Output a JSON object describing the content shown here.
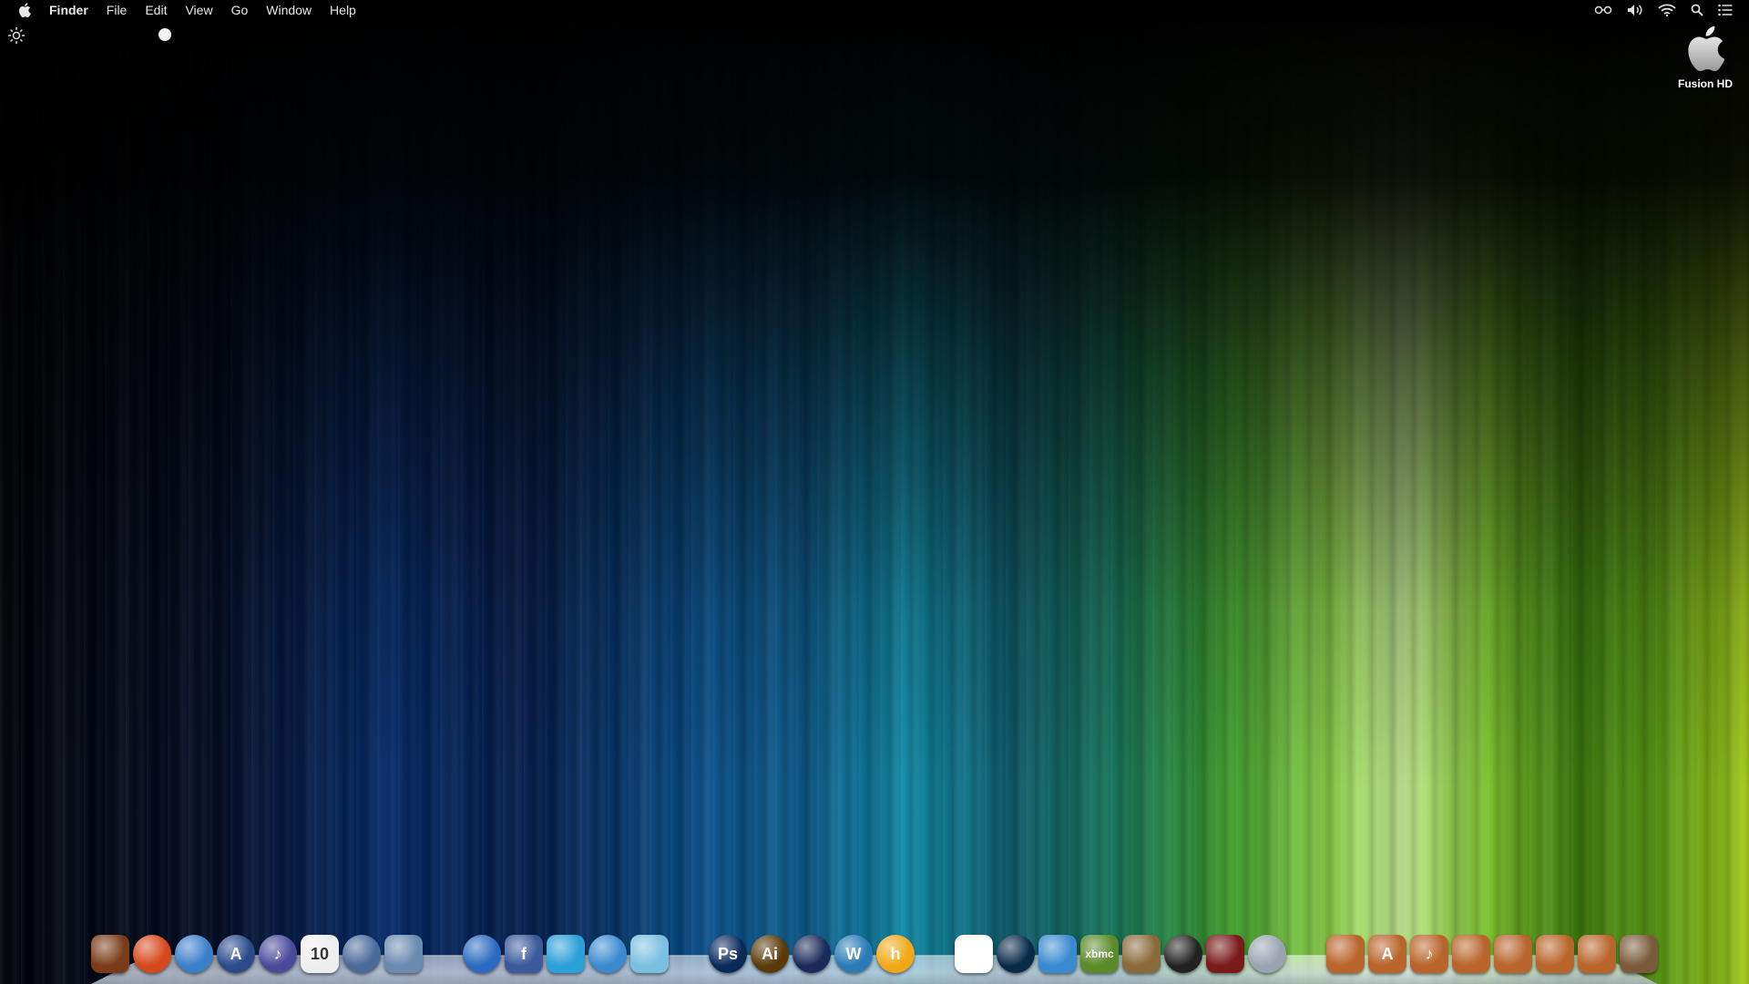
{
  "menubar": {
    "app_name": "Finder",
    "menus": [
      "File",
      "Edit",
      "View",
      "Go",
      "Window",
      "Help"
    ],
    "status_icons": [
      "glasses-icon",
      "volume-icon",
      "wifi-icon",
      "search-icon",
      "list-icon"
    ]
  },
  "desktop": {
    "drive_label": "Fusion HD"
  },
  "dock": {
    "apps": [
      {
        "name": "launch-app-icon",
        "glyph": "",
        "color": "#7a3b1a"
      },
      {
        "name": "firefox-icon",
        "glyph": "",
        "color": "#d6481a"
      },
      {
        "name": "safari-icon",
        "glyph": "",
        "color": "#3a7fc9"
      },
      {
        "name": "app-store-icon",
        "glyph": "A",
        "color": "#2a4a8a"
      },
      {
        "name": "itunes-icon",
        "glyph": "♪",
        "color": "#4a4a9a"
      },
      {
        "name": "calendar-icon",
        "glyph": "10",
        "color": "#eeeeee"
      },
      {
        "name": "launchpad-icon",
        "glyph": "",
        "color": "#4a6a9a"
      },
      {
        "name": "system-preferences-icon",
        "glyph": "",
        "color": "#6a8ab0"
      }
    ],
    "social": [
      {
        "name": "mail-icon",
        "glyph": "",
        "color": "#2a6ac0"
      },
      {
        "name": "facebook-icon",
        "glyph": "f",
        "color": "#3b5a9a"
      },
      {
        "name": "twitter-icon",
        "glyph": "",
        "color": "#2aa0d8"
      },
      {
        "name": "messages-icon",
        "glyph": "",
        "color": "#3a8ad0"
      },
      {
        "name": "notes-icon",
        "glyph": "",
        "color": "#7ac0e0"
      }
    ],
    "design": [
      {
        "name": "photoshop-icon",
        "glyph": "Ps",
        "color": "#0a2a5a"
      },
      {
        "name": "illustrator-icon",
        "glyph": "Ai",
        "color": "#5a3a08"
      },
      {
        "name": "cinema4d-icon",
        "glyph": "",
        "color": "#1a2a5a"
      },
      {
        "name": "wordpress-icon",
        "glyph": "W",
        "color": "#2a7ab8"
      },
      {
        "name": "theme-icon",
        "glyph": "h",
        "color": "#f0a818"
      }
    ],
    "tools": [
      {
        "name": "windows-icon",
        "glyph": "",
        "color": "#ffffff"
      },
      {
        "name": "dashboard-icon",
        "glyph": "",
        "color": "#0a2a4a"
      },
      {
        "name": "quicktime-icon",
        "glyph": "",
        "color": "#3a8ad0"
      },
      {
        "name": "xbmc-icon",
        "glyph": "xbmc",
        "color": "#5a8a2a"
      },
      {
        "name": "iphoto-icon",
        "glyph": "",
        "color": "#8a6a3a"
      },
      {
        "name": "camera-lens-icon",
        "glyph": "",
        "color": "#222222"
      },
      {
        "name": "mixer-icon",
        "glyph": "",
        "color": "#7a1a1a"
      },
      {
        "name": "disk-utility-icon",
        "glyph": "",
        "color": "#9aa4b0"
      }
    ],
    "folders": [
      {
        "name": "folder-icon",
        "glyph": "",
        "color": "#b8642a"
      },
      {
        "name": "applications-folder-icon",
        "glyph": "A",
        "color": "#b8642a"
      },
      {
        "name": "music-folder-icon",
        "glyph": "♪",
        "color": "#b8642a"
      },
      {
        "name": "movies-folder-icon",
        "glyph": "",
        "color": "#b8642a"
      },
      {
        "name": "user-folder-icon",
        "glyph": "",
        "color": "#b8642a"
      },
      {
        "name": "pictures-folder-icon",
        "glyph": "",
        "color": "#b8642a"
      },
      {
        "name": "downloads-folder-icon",
        "glyph": "",
        "color": "#b8642a"
      },
      {
        "name": "trash-icon",
        "glyph": "",
        "color": "#7a5a3a"
      }
    ]
  }
}
